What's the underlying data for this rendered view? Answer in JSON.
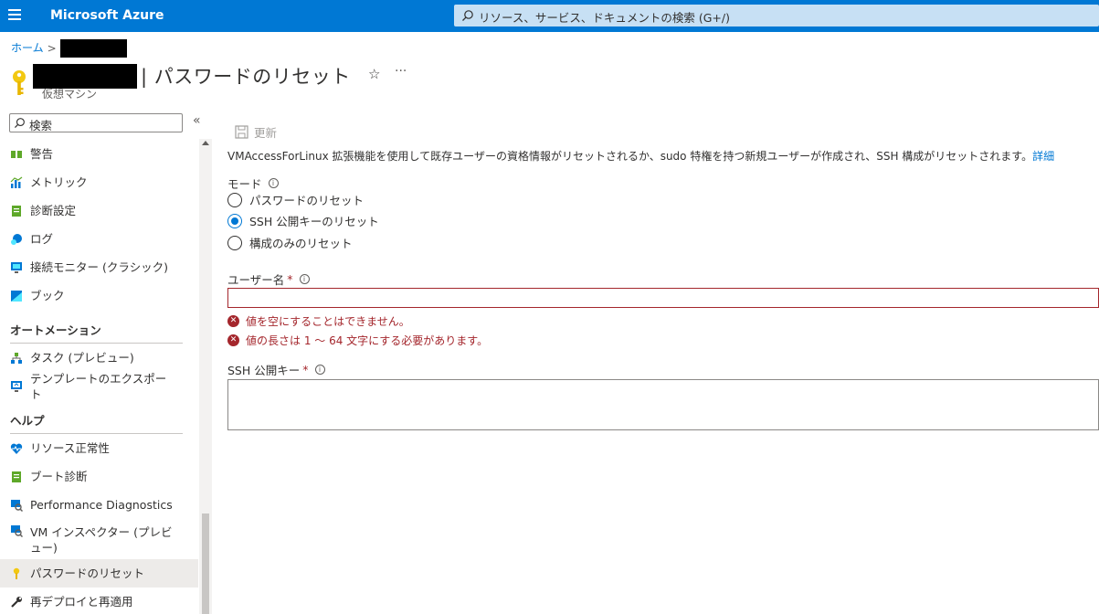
{
  "topbar": {
    "brand": "Microsoft Azure",
    "search_placeholder": "リソース、サービス、ドキュメントの検索 (G+/)"
  },
  "breadcrumb": {
    "home": "ホーム",
    "separator": ">"
  },
  "header": {
    "title": "| パスワードのリセット",
    "subtitle": "仮想マシン",
    "star": "☆",
    "more": "···"
  },
  "sidebar": {
    "search_placeholder": "検索",
    "collapse": "«",
    "items_top": [
      {
        "label": "警告",
        "icon": "alert-icon"
      },
      {
        "label": "メトリック",
        "icon": "metrics-icon"
      },
      {
        "label": "診断設定",
        "icon": "diagnostic-settings-icon"
      },
      {
        "label": "ログ",
        "icon": "logs-icon"
      },
      {
        "label": "接続モニター (クラシック)",
        "icon": "connection-monitor-icon"
      },
      {
        "label": "ブック",
        "icon": "workbook-icon"
      }
    ],
    "section_automation": "オートメーション",
    "items_automation": [
      {
        "label": "タスク (プレビュー)",
        "icon": "tasks-icon"
      },
      {
        "label": "テンプレートのエクスポート",
        "icon": "export-template-icon"
      }
    ],
    "section_help": "ヘルプ",
    "items_help": [
      {
        "label": "リソース正常性",
        "icon": "resource-health-icon"
      },
      {
        "label": "ブート診断",
        "icon": "boot-diagnostics-icon"
      },
      {
        "label": "Performance Diagnostics",
        "icon": "performance-diagnostics-icon"
      },
      {
        "label": "VM インスペクター (プレビュー)",
        "icon": "vm-inspector-icon"
      },
      {
        "label": "パスワードのリセット",
        "icon": "key-icon",
        "active": true
      },
      {
        "label": "再デプロイと再適用",
        "icon": "wrench-icon"
      }
    ]
  },
  "main": {
    "refresh_label": "更新",
    "description": "VMAccessForLinux 拡張機能を使用して既存ユーザーの資格情報がリセットされるか、sudo 特権を持つ新規ユーザーが作成され、SSH 構成がリセットされます。",
    "description_link": "詳細",
    "mode_label": "モード",
    "mode_options": [
      {
        "label": "パスワードのリセット",
        "checked": false
      },
      {
        "label": "SSH 公開キーのリセット",
        "checked": true
      },
      {
        "label": "構成のみのリセット",
        "checked": false
      }
    ],
    "username_label": "ユーザー名",
    "required_mark": "*",
    "username_value": "",
    "errors": [
      "値を空にすることはできません。",
      "値の長さは 1 ～ 64 文字にする必要があります。"
    ],
    "ssh_key_label": "SSH 公開キー",
    "ssh_key_value": ""
  },
  "colors": {
    "accent": "#0078d4",
    "error": "#a4262c",
    "search_bg": "#c7e0f4"
  }
}
